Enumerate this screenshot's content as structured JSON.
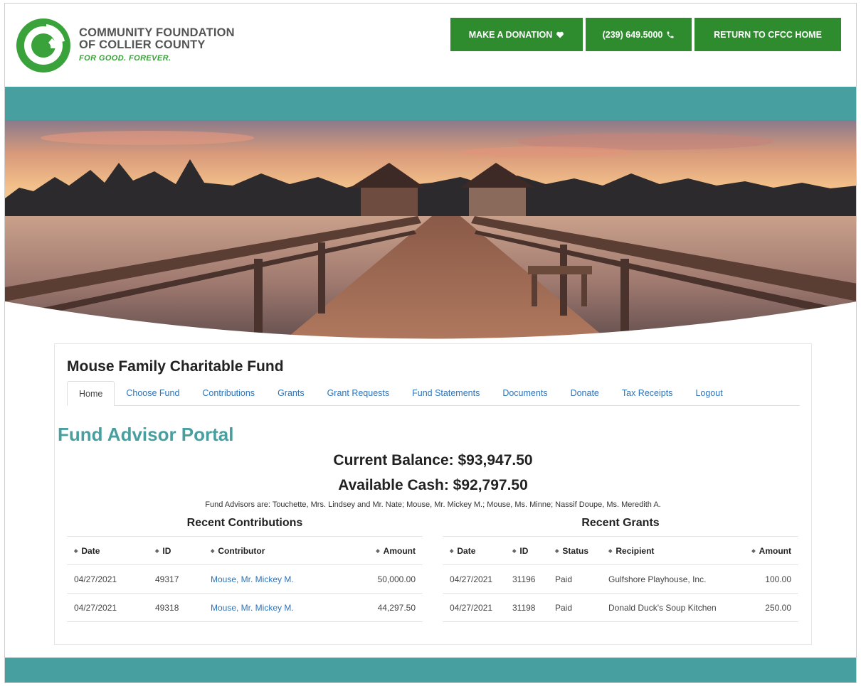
{
  "header": {
    "org_line1": "COMMUNITY FOUNDATION",
    "org_line2": "OF COLLIER COUNTY",
    "tagline": "FOR GOOD. FOREVER.",
    "donate_label": "MAKE A DONATION",
    "phone_label": "(239) 649.5000",
    "home_label": "RETURN TO CFCC HOME"
  },
  "fund": {
    "title": "Mouse Family Charitable Fund"
  },
  "tabs": [
    {
      "label": "Home",
      "active": true
    },
    {
      "label": "Choose Fund"
    },
    {
      "label": "Contributions"
    },
    {
      "label": "Grants"
    },
    {
      "label": "Grant Requests"
    },
    {
      "label": "Fund Statements"
    },
    {
      "label": "Documents"
    },
    {
      "label": "Donate"
    },
    {
      "label": "Tax Receipts"
    },
    {
      "label": "Logout"
    }
  ],
  "portal": {
    "title": "Fund Advisor Portal",
    "current_balance": "Current Balance: $93,947.50",
    "available_cash": "Available Cash: $92,797.50",
    "advisors": "Fund Advisors are: Touchette, Mrs. Lindsey and Mr. Nate; Mouse, Mr. Mickey M.; Mouse, Ms. Minne; Nassif Doupe, Ms. Meredith A."
  },
  "contributions": {
    "title": "Recent Contributions",
    "headers": [
      "Date",
      "ID",
      "Contributor",
      "Amount"
    ],
    "rows": [
      {
        "date": "04/27/2021",
        "id": "49317",
        "contributor": "Mouse, Mr. Mickey M.",
        "amount": "50,000.00"
      },
      {
        "date": "04/27/2021",
        "id": "49318",
        "contributor": "Mouse, Mr. Mickey M.",
        "amount": "44,297.50"
      }
    ]
  },
  "grants": {
    "title": "Recent Grants",
    "headers": [
      "Date",
      "ID",
      "Status",
      "Recipient",
      "Amount"
    ],
    "rows": [
      {
        "date": "04/27/2021",
        "id": "31196",
        "status": "Paid",
        "recipient": "Gulfshore Playhouse, Inc.",
        "amount": "100.00"
      },
      {
        "date": "04/27/2021",
        "id": "31198",
        "status": "Paid",
        "recipient": "Donald Duck's Soup Kitchen",
        "amount": "250.00"
      }
    ]
  },
  "colors": {
    "brand_green": "#2e8b2e",
    "teal": "#479f9f",
    "link": "#2d73b8"
  },
  "icons": {
    "donate": "heart-icon",
    "phone": "phone-icon"
  }
}
